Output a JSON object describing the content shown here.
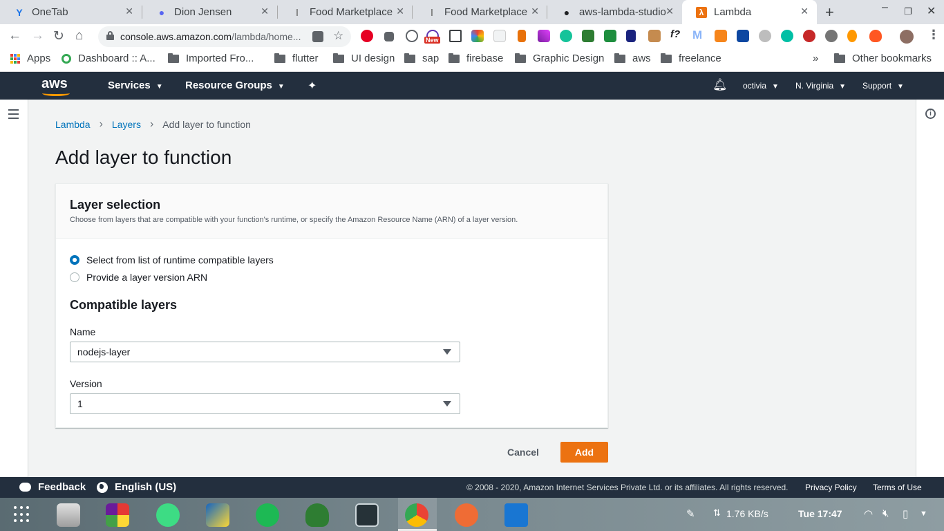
{
  "browser": {
    "tabs": [
      {
        "title": "OneTab",
        "icon": "onetab-icon",
        "color": "#1a73e8",
        "glyph": "Y"
      },
      {
        "title": "Dion Jensen",
        "icon": "discord-icon",
        "color": "#5865f2",
        "glyph": "●"
      },
      {
        "title": "Food Marketplace",
        "icon": "spoon-icon",
        "color": "#777777",
        "glyph": "ǀ"
      },
      {
        "title": "Food Marketplace",
        "icon": "spoon-icon",
        "color": "#777777",
        "glyph": "ǀ"
      },
      {
        "title": "aws-lambda-studio",
        "icon": "github-icon",
        "color": "#202124",
        "glyph": "●"
      },
      {
        "title": "Lambda",
        "icon": "aws-lambda-icon",
        "color": "#ec7211",
        "glyph": "λ"
      }
    ],
    "close_glyph": "✕",
    "new_tab_glyph": "+",
    "url_host": "console.aws.amazon.com",
    "url_path": "/lambda/home...",
    "bookmarks": [
      {
        "label": "Apps",
        "type": "apps"
      },
      {
        "label": "Dashboard :: A...",
        "type": "site"
      },
      {
        "label": "Imported Fro...",
        "type": "folder"
      },
      {
        "label": "flutter",
        "type": "folder"
      },
      {
        "label": "UI design",
        "type": "folder"
      },
      {
        "label": "sap",
        "type": "folder"
      },
      {
        "label": "firebase",
        "type": "folder"
      },
      {
        "label": "Graphic Design",
        "type": "folder"
      },
      {
        "label": "aws",
        "type": "folder"
      },
      {
        "label": "freelance",
        "type": "folder"
      }
    ],
    "bookmarks_overflow": "»",
    "other_bookmarks": "Other bookmarks",
    "ext_new_badge": "New"
  },
  "aws_nav": {
    "logo": "aws",
    "services": "Services",
    "resource_groups": "Resource Groups",
    "account": "octivia",
    "region": "N. Virginia",
    "support": "Support"
  },
  "breadcrumb": {
    "root": "Lambda",
    "parent": "Layers",
    "current": "Add layer to function",
    "separator": "›"
  },
  "page": {
    "title": "Add layer to function"
  },
  "layer_selection": {
    "heading": "Layer selection",
    "description": "Choose from layers that are compatible with your function's runtime, or specify the Amazon Resource Name (ARN) of a layer version.",
    "options": [
      {
        "label": "Select from list of runtime compatible layers",
        "selected": true
      },
      {
        "label": "Provide a layer version ARN",
        "selected": false
      }
    ]
  },
  "compatible_layers": {
    "heading": "Compatible layers",
    "name_label": "Name",
    "name_value": "nodejs-layer",
    "version_label": "Version",
    "version_value": "1"
  },
  "actions": {
    "cancel": "Cancel",
    "add": "Add"
  },
  "footer": {
    "feedback": "Feedback",
    "language": "English (US)",
    "copyright": "© 2008 - 2020, Amazon Internet Services Private Ltd. or its affiliates. All rights reserved.",
    "privacy": "Privacy Policy",
    "terms": "Terms of Use"
  },
  "taskbar": {
    "network_speed": "1.76 KB/s",
    "clock": "Tue 17:47"
  },
  "colors": {
    "aws_navy": "#232f3e",
    "aws_orange": "#ec7211",
    "link_blue": "#0073bb"
  }
}
